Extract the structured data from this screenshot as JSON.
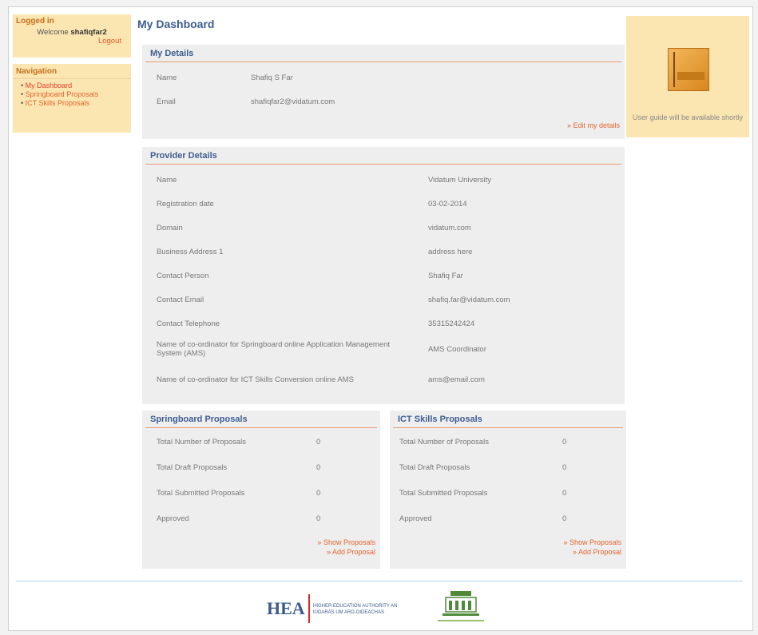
{
  "left": {
    "login_heading": "Logged in",
    "welcome_prefix": "Welcome",
    "username": "shafiqfar2",
    "logout": "Logout",
    "nav_heading": "Navigation",
    "nav_items": [
      "My Dashboard",
      "Springboard Proposals",
      "ICT Skills Proposals"
    ]
  },
  "page_title": "My Dashboard",
  "my_details": {
    "heading": "My Details",
    "rows": [
      {
        "label": "Name",
        "value": "Shafiq S Far"
      },
      {
        "label": "Email",
        "value": "shafiqfar2@vidatum.com"
      }
    ],
    "edit_link": "» Edit my details"
  },
  "provider": {
    "heading": "Provider Details",
    "rows": [
      {
        "label": "Name",
        "value": "Vidatum University"
      },
      {
        "label": "Registration date",
        "value": "03-02-2014"
      },
      {
        "label": "Domain",
        "value": "vidatum.com"
      },
      {
        "label": "Business Address 1",
        "value": "address here"
      },
      {
        "label": "Contact Person",
        "value": "Shafiq Far"
      },
      {
        "label": "Contact Email",
        "value": "shafiq.far@vidatum.com"
      },
      {
        "label": "Contact Telephone",
        "value": "35315242424"
      },
      {
        "label": "Name of co-ordinator for Springboard online Application Management System (AMS)",
        "value": "AMS Coordinator"
      },
      {
        "label": "Name of co-ordinator for ICT Skills Conversion online AMS",
        "value": "ams@email.com"
      }
    ]
  },
  "springboard": {
    "heading": "Springboard Proposals",
    "rows": [
      {
        "label": "Total Number of Proposals",
        "value": "0"
      },
      {
        "label": "Total Draft Proposals",
        "value": "0"
      },
      {
        "label": "Total Submitted Proposals",
        "value": "0"
      },
      {
        "label": "Approved",
        "value": "0"
      }
    ],
    "show_link": "» Show Proposals",
    "add_link": "» Add Proposal"
  },
  "ict": {
    "heading": "ICT Skills Proposals",
    "rows": [
      {
        "label": "Total Number of Proposals",
        "value": "0"
      },
      {
        "label": "Total Draft Proposals",
        "value": "0"
      },
      {
        "label": "Total Submitted Proposals",
        "value": "0"
      },
      {
        "label": "Approved",
        "value": "0"
      }
    ],
    "show_link": "» Show Proposals",
    "add_link": "» Add Proposal"
  },
  "user_guide": "User guide will be available shortly",
  "footer": {
    "hea": "HEA",
    "hea_text": "HIGHER EDUCATION AUTHORITY AN tÚDARÁS UM ARD-OIDEACHAS"
  }
}
